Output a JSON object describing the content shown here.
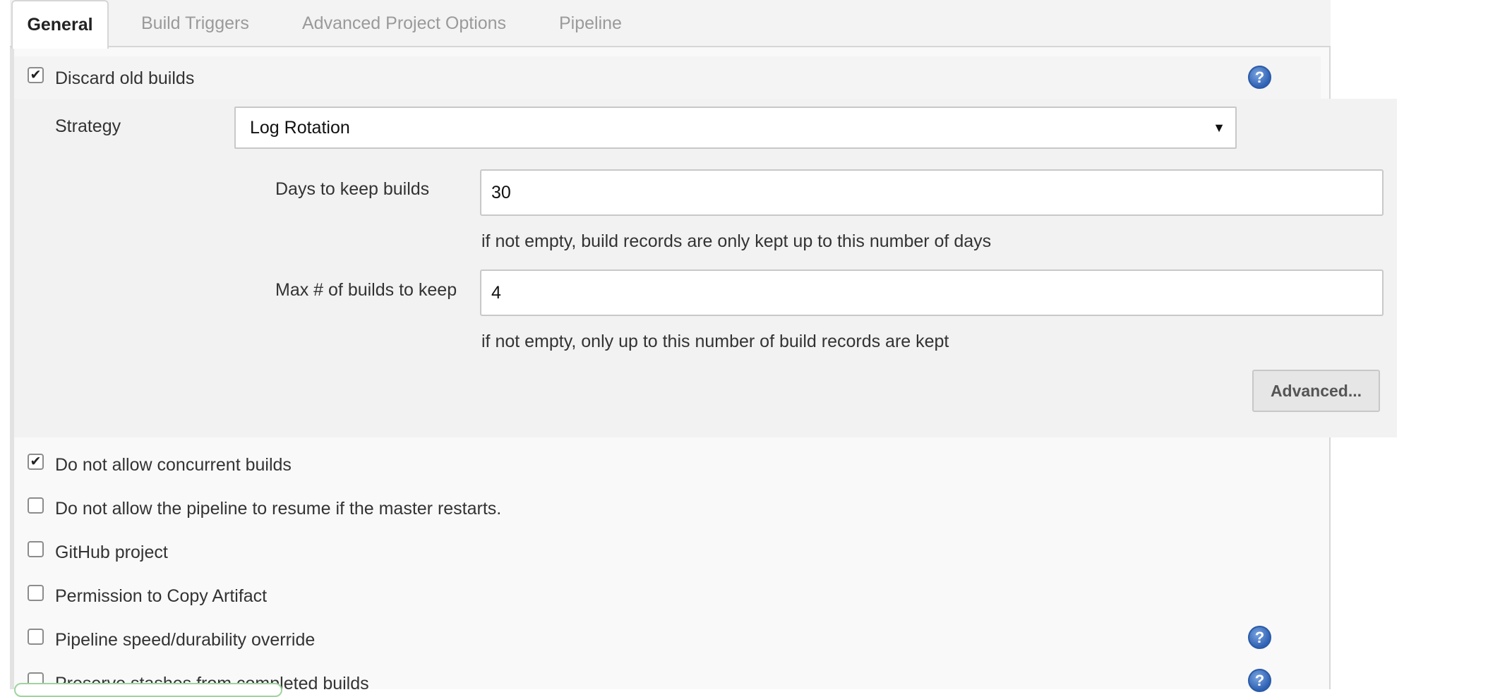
{
  "tabs": [
    {
      "label": "General",
      "active": true
    },
    {
      "label": "Build Triggers",
      "active": false
    },
    {
      "label": "Advanced Project Options",
      "active": false
    },
    {
      "label": "Pipeline",
      "active": false
    }
  ],
  "discard": {
    "label": "Discard old builds",
    "checked": true,
    "strategy_label": "Strategy",
    "strategy_value": "Log Rotation",
    "days_label": "Days to keep builds",
    "days_value": "30",
    "days_hint": "if not empty, build records are only kept up to this number of days",
    "max_label": "Max # of builds to keep",
    "max_value": "4",
    "max_hint": "if not empty, only up to this number of build records are kept",
    "advanced_button": "Advanced..."
  },
  "options": [
    {
      "label": "Do not allow concurrent builds",
      "checked": true,
      "help": false
    },
    {
      "label": "Do not allow the pipeline to resume if the master restarts.",
      "checked": false,
      "help": false
    },
    {
      "label": "GitHub project",
      "checked": false,
      "help": false
    },
    {
      "label": "Permission to Copy Artifact",
      "checked": false,
      "help": false
    },
    {
      "label": "Pipeline speed/durability override",
      "checked": false,
      "help": true
    },
    {
      "label": "Preserve stashes from completed builds",
      "checked": false,
      "help": true
    }
  ],
  "icons": {
    "help": "help-icon",
    "check": "checkmark-icon",
    "dropdown": "caret-down-icon"
  },
  "glyphs": {
    "check": "✔",
    "help": "?",
    "caret": "▼"
  },
  "colors": {
    "help_blue": "#2f62b4",
    "panel_bg": "#f9f9f9",
    "section_bg": "#f2f2f2"
  }
}
